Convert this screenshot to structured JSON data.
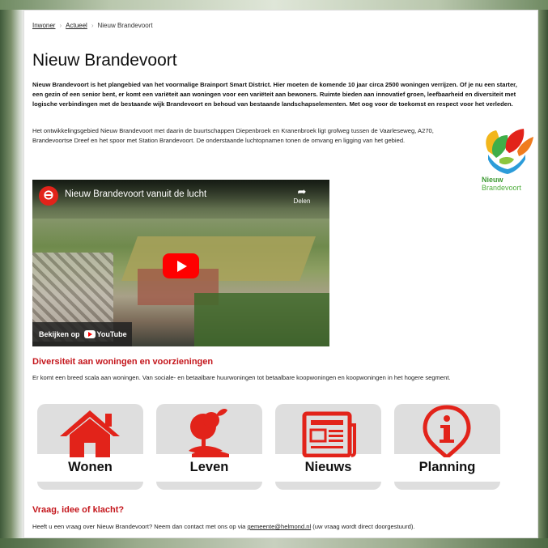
{
  "breadcrumb": {
    "items": [
      "Inwoner",
      "Actueel",
      "Nieuw Brandevoort"
    ]
  },
  "page": {
    "title": "Nieuw Brandevoort",
    "intro": "Nieuw Brandevoort is het plangebied van het voormalige Brainport Smart District. Hier moeten de komende 10 jaar circa 2500 woningen verrijzen. Of je nu een starter, een gezin of een senior bent, er komt een variëteit aan woningen voor een variëteit aan bewoners. Ruimte bieden aan innovatief groen, leefbaarheid en diversiteit met logische verbindingen met de bestaande wijk Brandevoort en behoud van bestaande landschapselementen. Met oog voor de toekomst en respect voor het verleden.",
    "body": "Het ontwikkelingsgebied Nieuw Brandevoort met daarin de buurtschappen Diepenbroek en Kranenbroek ligt grofweg tussen de Vaarleseweg, A270, Brandevoortse Dreef en het spoor met Station Brandevoort. De onderstaande luchtopnamen tonen de omvang en ligging van het gebied."
  },
  "logo": {
    "line1": "Nieuw",
    "line2": "Brandevoort"
  },
  "video": {
    "title": "Nieuw Brandevoort vanuit de lucht",
    "share_label": "Delen",
    "watch_label": "Bekijken op",
    "youtube_label": "YouTube"
  },
  "section_diversity": {
    "heading": "Diversiteit aan woningen en voorzieningen",
    "text": "Er komt een breed scala aan woningen. Van sociale- en betaalbare huurwoningen tot betaalbare koopwoningen en koopwoningen in het hogere segment."
  },
  "tiles": [
    {
      "label": "Wonen",
      "icon": "house-icon"
    },
    {
      "label": "Leven",
      "icon": "tree-icon"
    },
    {
      "label": "Nieuws",
      "icon": "newspaper-icon"
    },
    {
      "label": "Planning",
      "icon": "info-icon"
    }
  ],
  "section_contact": {
    "heading": "Vraag, idee of klacht?",
    "text_before": "Heeft u een vraag over Nieuw Brandevoort? Neem dan contact met ons op via ",
    "email": "gemeente@helmond.nl",
    "text_after": " (uw vraag wordt direct doorgestuurd)."
  },
  "colors": {
    "accent_red": "#c4161c",
    "tile_icon_red": "#e2231a",
    "logo_green": "#3f9b35"
  }
}
